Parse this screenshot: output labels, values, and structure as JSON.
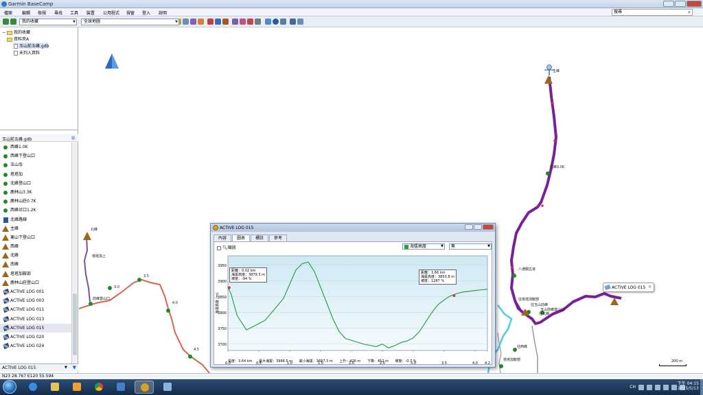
{
  "window": {
    "title": "Garmin BaseCamp"
  },
  "menu": [
    "檔案",
    "編輯",
    "檢視",
    "尋找",
    "工具",
    "裝置",
    "公用程式",
    "視窗",
    "登入",
    "說明"
  ],
  "search": {
    "placeholder": "搜尋"
  },
  "toolbar": {
    "device_dropdown": "我的收藏",
    "map_dropdown": "全球地圖"
  },
  "tree": {
    "root": "我的收藏",
    "folder": "資料夾A",
    "file": "玉山前五峰.gdb",
    "unlisted": "未列入資料"
  },
  "list": {
    "header": "玉山前五峰.gdb",
    "items": [
      {
        "icon": "waypoint",
        "label": "西峰1.0K"
      },
      {
        "icon": "waypoint",
        "label": "西峰下登山口"
      },
      {
        "icon": "waypoint",
        "label": "玉山寺"
      },
      {
        "icon": "waypoint",
        "label": "塔塔加"
      },
      {
        "icon": "waypoint",
        "label": "北峰登山口"
      },
      {
        "icon": "waypoint",
        "label": "鹿林山3.3K"
      },
      {
        "icon": "waypoint",
        "label": "鹿林山莊0.7K"
      },
      {
        "icon": "waypoint",
        "label": "西峰岔口1.2K"
      },
      {
        "icon": "route",
        "label": "北峰路線"
      },
      {
        "icon": "geo",
        "label": "主峰"
      },
      {
        "icon": "geo",
        "label": "東山下登山口"
      },
      {
        "icon": "geo",
        "label": "西峰"
      },
      {
        "icon": "geo",
        "label": "北峰"
      },
      {
        "icon": "geo",
        "label": "南峰"
      },
      {
        "icon": "geo",
        "label": "塔塔加鞍部"
      },
      {
        "icon": "geo",
        "label": "鹿林山莊登山口"
      },
      {
        "icon": "track",
        "label": "ACTIVE LOG 001"
      },
      {
        "icon": "track",
        "label": "ACTIVE LOG 003"
      },
      {
        "icon": "track",
        "label": "ACTIVE LOG 011"
      },
      {
        "icon": "track",
        "label": "ACTIVE LOG 013"
      },
      {
        "icon": "track",
        "label": "ACTIVE LOG 015"
      },
      {
        "icon": "track",
        "label": "ACTIVE LOG 020"
      },
      {
        "icon": "track",
        "label": "ACTIVE LOG 024"
      }
    ],
    "footer": "ACTIVE LOG 015"
  },
  "status": {
    "coords": "N23 28.767 E120 55.594"
  },
  "map": {
    "popup": "ACTIVE LOG 015",
    "scale": "200 m",
    "labels": {
      "summit": "主峰",
      "north": "北峰",
      "mark_3_5k": "3.5K",
      "km40": "北峰3.0K",
      "fork": "八通關古道",
      "west_saddle": "往塔塔加鞍部",
      "east_road": "玉山前峰登山口",
      "junction": "往玉山前峰",
      "sw_saddle": "往北峰",
      "tataka_lower": "往西峰",
      "t30": "3.0",
      "t35": "3.5",
      "t40": "4.0",
      "t45": "4.5",
      "lulin": "鹿林",
      "stream": "前峰登山口",
      "peak_w": "塔塔加上",
      "south_a": "塔塔加鞍部",
      "south_b": "往鹿林山莊"
    }
  },
  "dialog": {
    "title": "ACTIVE LOG 015",
    "tabs": [
      "內容",
      "圖表",
      "標註",
      "參考"
    ],
    "active_tab": 1,
    "checkbox_label": "縮放",
    "series_label": "海拔高度",
    "secondary_select": "無",
    "y_axis_label": "海拔高度 (m)",
    "x_axis_label": "距離 (km)",
    "callout_left": [
      "距離：0.02 km",
      "海拔高度：3879.3 m",
      "坡度：-94 %"
    ],
    "callout_right": [
      "距離：3.66 km",
      "海拔高度：3853.8 m",
      "坡度：1287 %"
    ],
    "stats": [
      "長度：3.64 km",
      "最大海拔：3966.5 m",
      "最小海拔：3687.3 m",
      "上升：426 m",
      "下降：452 m",
      "坡度：-0.7 %"
    ]
  },
  "chart_data": {
    "type": "line",
    "xlabel": "距離 (km)",
    "ylabel": "海拔高度 (m)",
    "xlim": [
      0,
      4.2
    ],
    "ylim": [
      3680,
      3980
    ],
    "x_ticks": [
      "0.0",
      "0.5",
      "1.0",
      "1.5",
      "2.0",
      "2.5",
      "3.0",
      "3.5",
      "4.0",
      "4.2"
    ],
    "y_ticks": [
      "3700",
      "3750",
      "3800",
      "3850",
      "3900",
      "3950"
    ],
    "x": [
      0.0,
      0.05,
      0.15,
      0.3,
      0.45,
      0.6,
      0.75,
      0.9,
      1.0,
      1.1,
      1.2,
      1.3,
      1.4,
      1.5,
      1.6,
      1.7,
      1.8,
      1.9,
      2.0,
      2.2,
      2.4,
      2.5,
      2.6,
      2.7,
      2.8,
      2.9,
      3.0,
      3.1,
      3.2,
      3.3,
      3.4,
      3.5,
      3.6,
      3.7,
      3.8,
      4.0,
      4.1,
      4.2
    ],
    "y": [
      3879,
      3860,
      3790,
      3745,
      3760,
      3775,
      3810,
      3845,
      3890,
      3935,
      3955,
      3960,
      3930,
      3880,
      3830,
      3780,
      3740,
      3718,
      3712,
      3700,
      3692,
      3700,
      3688,
      3695,
      3705,
      3710,
      3720,
      3740,
      3770,
      3800,
      3825,
      3840,
      3853,
      3860,
      3865,
      3870,
      3872,
      3874
    ]
  },
  "taskbar": {
    "time": "下午 04:15",
    "date": "2015/5/13",
    "lang": "CH"
  }
}
